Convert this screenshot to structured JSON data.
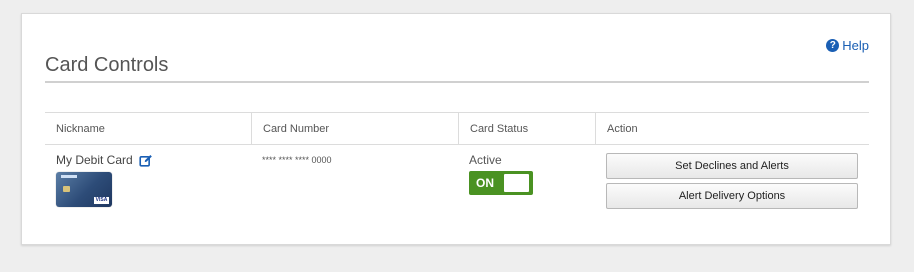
{
  "header": {
    "title": "Card Controls",
    "help_label": "Help"
  },
  "table": {
    "columns": [
      "Nickname",
      "Card Number",
      "Card Status",
      "Action"
    ],
    "rows": [
      {
        "nickname": "My Debit Card",
        "card_number": "**** **** **** 0000",
        "status": "Active",
        "toggle_label": "ON",
        "toggle_on": true,
        "actions": [
          "Set Declines and Alerts",
          "Alert Delivery Options"
        ]
      }
    ]
  },
  "colors": {
    "accent": "#1a5fb4",
    "toggle_on": "#4a9222"
  },
  "icons": {
    "help": "question-circle-icon",
    "edit": "edit-icon"
  }
}
